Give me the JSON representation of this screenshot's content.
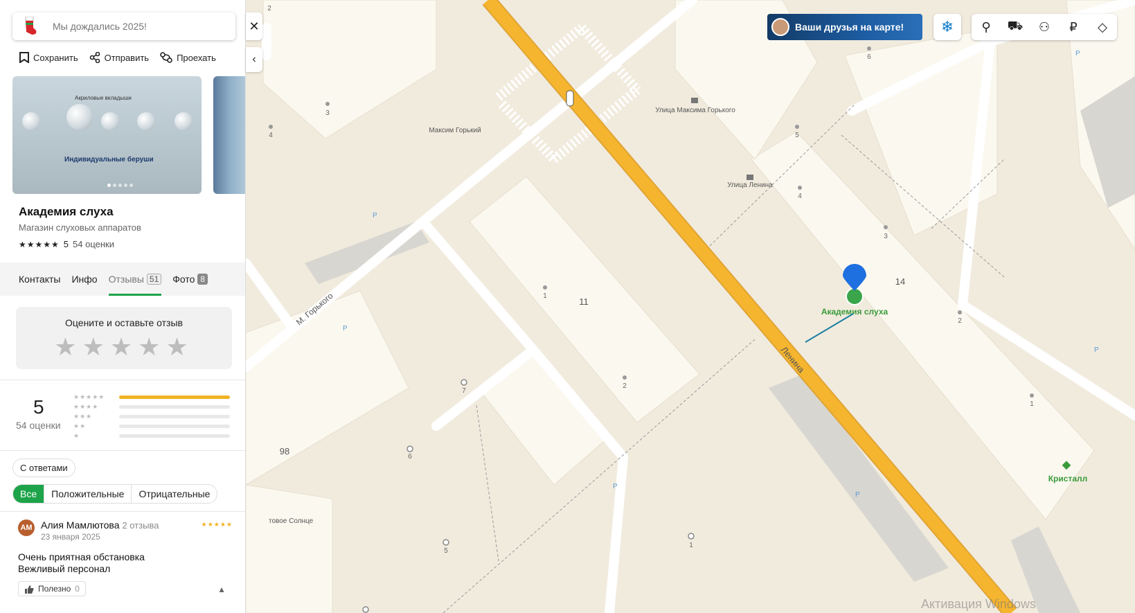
{
  "search": {
    "placeholder": "Мы дождались 2025!"
  },
  "actions": {
    "save": "Сохранить",
    "share": "Отправить",
    "route": "Проехать"
  },
  "org": {
    "title": "Академия слуха",
    "category": "Магазин слуховых аппаратов",
    "rating": "5",
    "rating_count": "54 оценки"
  },
  "photo": {
    "caption_top": "Акриловые вкладыши",
    "caption_main": "Индивидуальные беруши"
  },
  "tabs": [
    {
      "label": "Контакты"
    },
    {
      "label": "Инфо"
    },
    {
      "label": "Отзывы",
      "badge": "51"
    },
    {
      "label": "Фото",
      "badge": "8"
    }
  ],
  "rate_card": {
    "title": "Оцените и оставьте отзыв"
  },
  "summary": {
    "value": "5",
    "count": "54 оценки",
    "distribution": [
      1.0,
      0,
      0,
      0,
      0
    ]
  },
  "filters": {
    "with_answers": "С ответами",
    "all": "Все",
    "positive": "Положительные",
    "negative": "Отрицательные"
  },
  "review": {
    "initials": "АМ",
    "author": "Алия Мамлютова",
    "author_reviews": "2 отзыва",
    "date": "23 января 2025",
    "text_line1": "Очень приятная обстановка",
    "text_line2": "Вежливый персонал",
    "useful_label": "Полезно",
    "useful_count": "0",
    "stars": 5
  },
  "map": {
    "banner": "Ваши друзья на карте!",
    "street_lenina": "Ленина",
    "street_gorkogo": "М. Горького",
    "stop_gorkogo": "Улица Максима Горького",
    "stop_lenina": "Улица Ленина",
    "monument": "Максим Горький",
    "poi_main": "Академия слуха",
    "poi_crystal": "Кристалл",
    "poi_sun": "товое Солнце",
    "house_11": "11",
    "house_14": "14",
    "house_98": "98",
    "watermark": "Активация Windows",
    "accent": "#1da34a",
    "road_color": "#f5b52e"
  }
}
